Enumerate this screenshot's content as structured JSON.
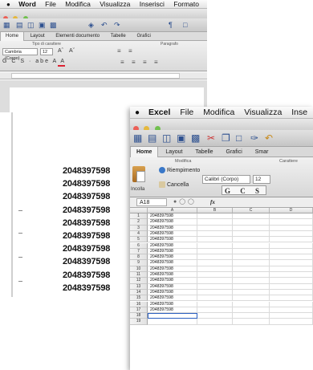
{
  "word": {
    "menu": {
      "apple": "",
      "app": "Word",
      "items": [
        "File",
        "Modifica",
        "Visualizza",
        "Inserisci",
        "Formato"
      ]
    },
    "ribbon_tabs": [
      "Home",
      "Layout",
      "Elementi documento",
      "Tabelle",
      "Grafici"
    ],
    "active_tab": "Home",
    "group_labels": [
      "Tipo di carattere",
      "Paragrafo"
    ],
    "font_name": "Cambria (Corpo)",
    "font_size": "12",
    "format_buttons": "G C S · abe A A",
    "lines": [
      "2048397598",
      "2048397598",
      "2048397598",
      "2048397598",
      "2048397598",
      "2048397598",
      "2048397598",
      "2048397598",
      "2048397598",
      "2048397598"
    ]
  },
  "excel": {
    "menu": {
      "apple": "",
      "app": "Excel",
      "items": [
        "File",
        "Modifica",
        "Visualizza",
        "Inse"
      ]
    },
    "ribbon_tabs": [
      "Home",
      "Layout",
      "Tabelle",
      "Grafici",
      "Smar"
    ],
    "active_tab": "Home",
    "group_labels": {
      "edit": "Modifica",
      "font": "Carattere"
    },
    "paste_label": "Incolla",
    "fill_label": "Riempimento",
    "clear_label": "Cancella",
    "font_name": "Calibri (Corpo)",
    "font_size": "12",
    "format_buttons": "G C S",
    "name_box": "A18",
    "fx_label": "fx",
    "columns": [
      "A",
      "B",
      "C",
      "D"
    ],
    "rows": [
      {
        "n": "1",
        "a": "2048397598"
      },
      {
        "n": "2",
        "a": "2048397598"
      },
      {
        "n": "3",
        "a": "2048397598"
      },
      {
        "n": "4",
        "a": "2048397598"
      },
      {
        "n": "5",
        "a": "2048397598"
      },
      {
        "n": "6",
        "a": "2048397598"
      },
      {
        "n": "7",
        "a": "2048397598"
      },
      {
        "n": "8",
        "a": "2048397598"
      },
      {
        "n": "9",
        "a": "2048397598"
      },
      {
        "n": "10",
        "a": "2048397598"
      },
      {
        "n": "11",
        "a": "2048397598"
      },
      {
        "n": "12",
        "a": "2048397598"
      },
      {
        "n": "13",
        "a": "2048397598"
      },
      {
        "n": "14",
        "a": "2048397598"
      },
      {
        "n": "15",
        "a": "2048397598"
      },
      {
        "n": "16",
        "a": "2048397598"
      },
      {
        "n": "17",
        "a": "2048397598"
      },
      {
        "n": "18",
        "a": ""
      },
      {
        "n": "19",
        "a": ""
      }
    ],
    "selected_row": "18"
  },
  "colors": {
    "selection": "#2a5fc0",
    "close": "#ec5f56",
    "minimize": "#e5b83d",
    "zoom": "#71c04e"
  }
}
